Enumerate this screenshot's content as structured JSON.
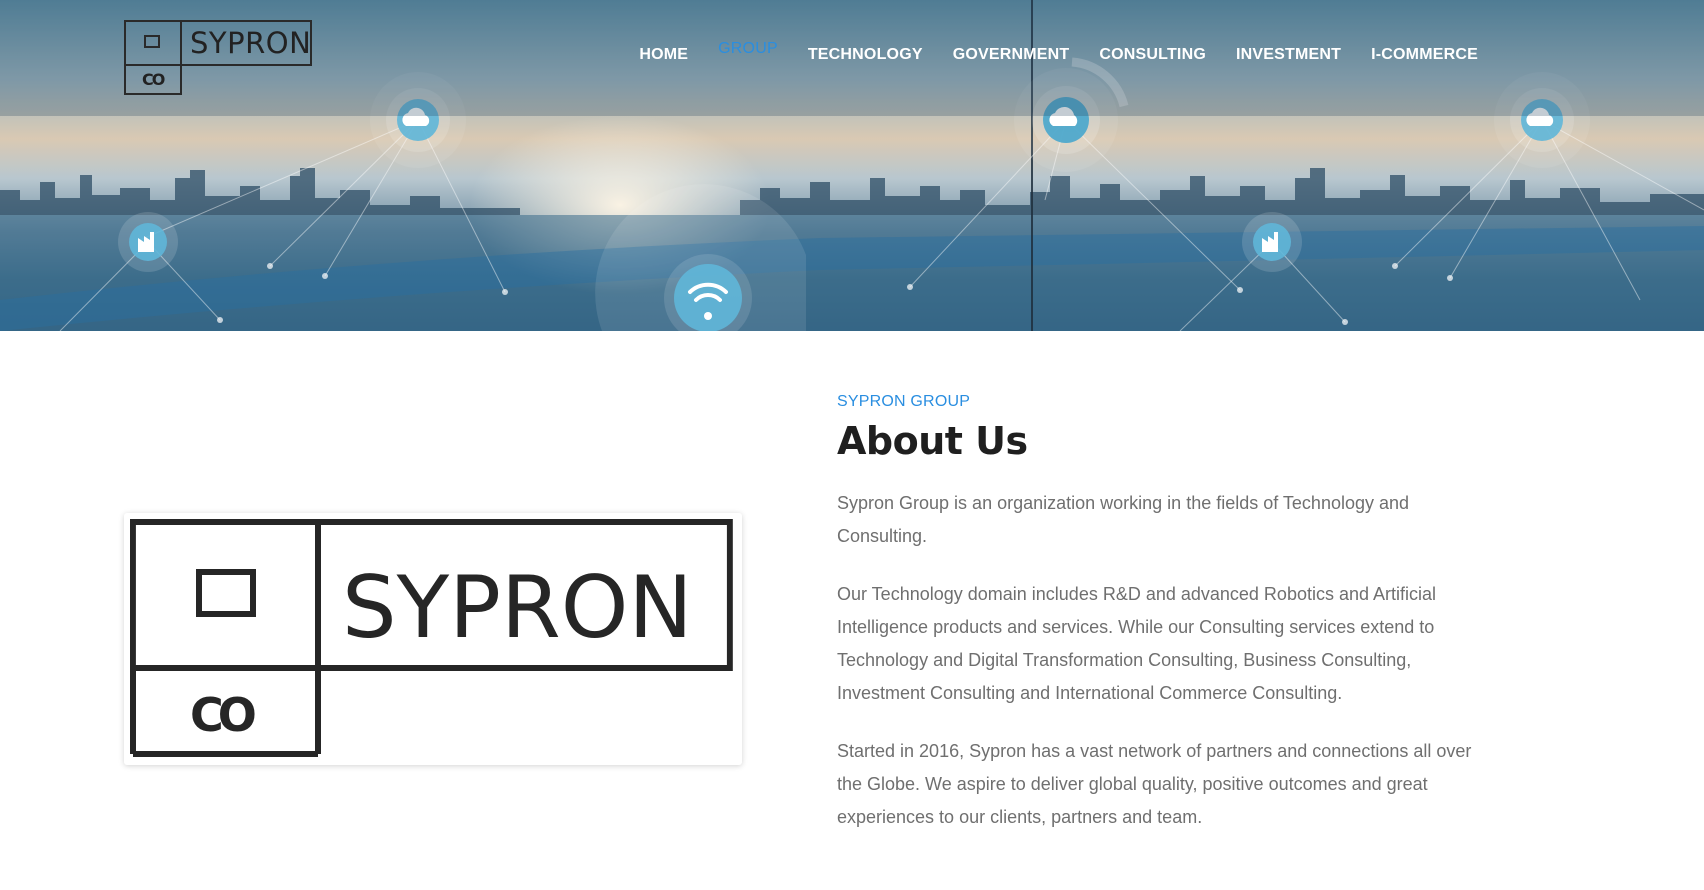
{
  "brand": {
    "name": "SYPRON",
    "sub": "CO"
  },
  "nav": {
    "items": [
      {
        "label": "HOME",
        "active": false
      },
      {
        "label": "GROUP",
        "active": true
      },
      {
        "label": "TECHNOLOGY",
        "active": false
      },
      {
        "label": "GOVERNMENT",
        "active": false
      },
      {
        "label": "CONSULTING",
        "active": false
      },
      {
        "label": "INVESTMENT",
        "active": false
      },
      {
        "label": "I-COMMERCE",
        "active": false
      }
    ],
    "active_color": "#2a8ee0"
  },
  "hero": {
    "icons": [
      "cloud-icon",
      "cloud-upload-icon",
      "factory-icon",
      "wifi-icon"
    ]
  },
  "about": {
    "eyebrow": "SYPRON GROUP",
    "title": "About Us",
    "paragraphs": [
      "Sypron Group is an organization working in the fields of Technology and Consulting.",
      "Our Technology domain includes R&D and advanced Robotics and Artificial Intelligence products and services. While our Consulting services extend to Technology and Digital Transformation Consulting, Business Consulting, Investment Consulting and International Commerce Consulting.",
      "Started in 2016, Sypron has a vast network of partners and connections all over the Globe. We aspire to deliver global quality, positive outcomes and great experiences to our clients, partners and team."
    ]
  },
  "colors": {
    "accent": "#2a8ee0",
    "heading": "#1f1f1f",
    "body_text": "#6f6f6f"
  }
}
